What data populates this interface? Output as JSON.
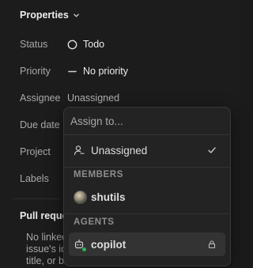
{
  "properties": {
    "title": "Properties",
    "rows": {
      "status": {
        "label": "Status",
        "value": "Todo"
      },
      "priority": {
        "label": "Priority",
        "value": "No priority"
      },
      "assignee": {
        "label": "Assignee",
        "value": "Unassigned"
      },
      "due_date": {
        "label": "Due date"
      },
      "project": {
        "label": "Project"
      },
      "labels": {
        "label": "Labels"
      }
    }
  },
  "pull_requests": {
    "title": "Pull reque",
    "body_lines": [
      "No linked",
      "issue's id",
      "title, or body to auto-link it."
    ]
  },
  "assign_dropdown": {
    "search_placeholder": "Assign to...",
    "unassigned_label": "Unassigned",
    "members_header": "MEMBERS",
    "members": [
      {
        "name": "shutils"
      }
    ],
    "agents_header": "AGENTS",
    "agents": [
      {
        "name": "copilot",
        "status_color": "#2fb35a"
      }
    ]
  },
  "colors": {
    "background": "#1c1c1c",
    "dropdown_bg": "#232323",
    "highlight": "#333333",
    "text_primary": "#ececec",
    "text_muted": "#a8a8a8"
  },
  "icons": {
    "section_chevron": "chevron-down-icon",
    "status": "todo-circle-icon",
    "priority": "no-priority-dash-icon",
    "unassigned": "user-unassigned-icon",
    "selected": "check-icon",
    "agent": "bot-icon",
    "agent_trailing": "lock-icon"
  }
}
